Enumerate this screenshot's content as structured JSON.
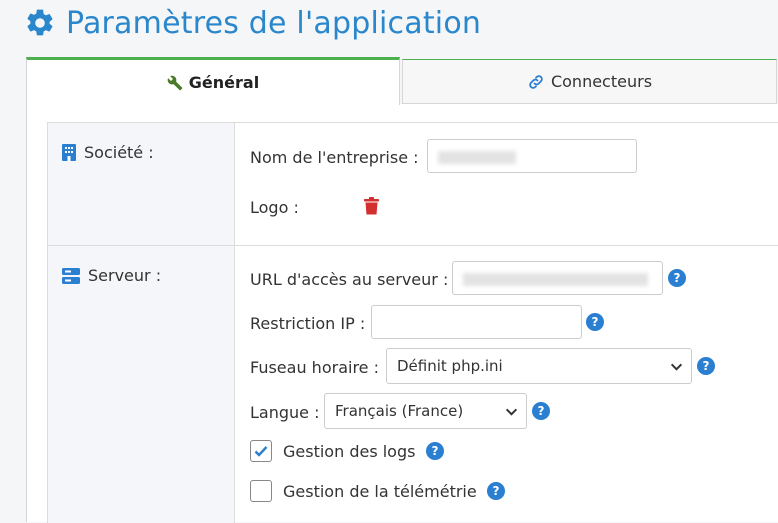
{
  "page": {
    "title": "Paramètres de l'application"
  },
  "tabs": [
    {
      "label": "Général",
      "icon": "wrench-icon",
      "active": true
    },
    {
      "label": "Connecteurs",
      "icon": "link-icon",
      "active": false
    }
  ],
  "colors": {
    "accent": "#2a87cc",
    "tab_active_border": "#4caf50",
    "help": "#2a7fd0",
    "delete": "#d32f2f"
  },
  "societe": {
    "section_label": "Société :",
    "company_name_label": "Nom de l'entreprise :",
    "company_name_value": "",
    "logo_label": "Logo :"
  },
  "serveur": {
    "section_label": "Serveur :",
    "url_label": "URL d'accès au serveur :",
    "url_value": "",
    "ip_label": "Restriction IP :",
    "ip_value": "",
    "timezone_label": "Fuseau horaire :",
    "timezone_value": "Définit php.ini",
    "language_label": "Langue :",
    "language_value": "Français (France)",
    "logs_label": "Gestion des logs",
    "logs_checked": true,
    "telemetry_label": "Gestion de la télémétrie",
    "telemetry_checked": false
  },
  "help_glyph": "?"
}
